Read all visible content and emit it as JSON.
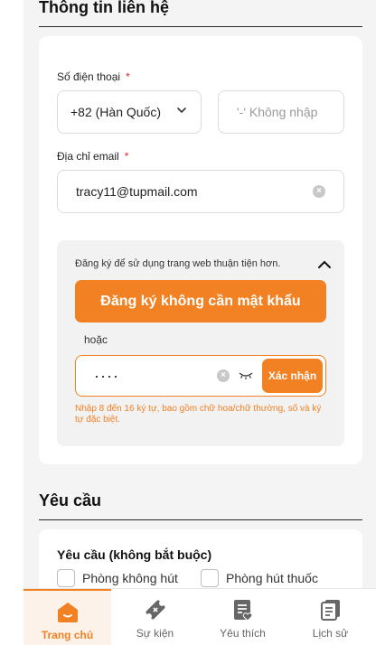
{
  "contact": {
    "title": "Thông tin liên hệ",
    "phone_label": "Số điện thoại",
    "required_mark": "*",
    "country_code": "+82 (Hàn Quốc)",
    "phone_placeholder": "'-' Không nhập",
    "email_label": "Địa chỉ email",
    "email_value": "tracy11@tupmail.com"
  },
  "register": {
    "info_text": "Đăng ký để sử dụng trang web thuận tiện hơn.",
    "no_password_button": "Đăng ký không cần mật khẩu",
    "or_text": "hoặc",
    "password_value": "····",
    "confirm_button": "Xác nhận",
    "hint": "Nhập 8 đến 16 ký tự, bao gồm chữ hoa/chữ thường, số và ký tự đặc biệt."
  },
  "request": {
    "title": "Yêu cầu",
    "subtitle": "Yêu cầu (không bắt buộc)",
    "options": [
      "Phòng không hút",
      "Phòng hút thuốc"
    ]
  },
  "nav": {
    "items": [
      {
        "label": "Trang chủ",
        "icon": "home-icon"
      },
      {
        "label": "Sự kiện",
        "icon": "ticket-icon"
      },
      {
        "label": "Yêu thích",
        "icon": "favorite-list-icon"
      },
      {
        "label": "Lịch sử",
        "icon": "history-icon"
      }
    ]
  },
  "colors": {
    "accent": "#f28123",
    "required": "#e0232b"
  }
}
